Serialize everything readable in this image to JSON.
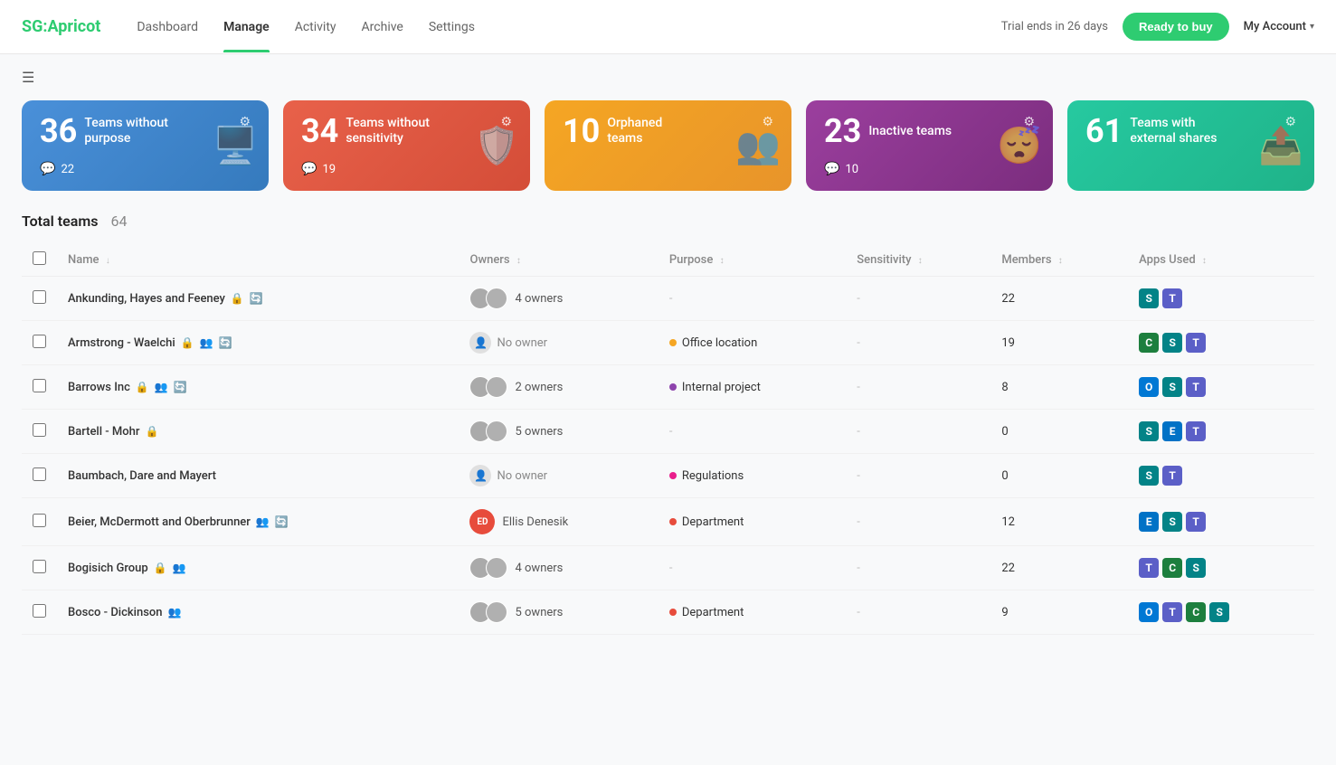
{
  "brand": {
    "logo_sg": "SG:",
    "logo_apricot": "Apricot"
  },
  "nav": {
    "links": [
      {
        "label": "Dashboard",
        "active": false
      },
      {
        "label": "Manage",
        "active": true
      },
      {
        "label": "Activity",
        "active": false
      },
      {
        "label": "Archive",
        "active": false
      },
      {
        "label": "Settings",
        "active": false
      }
    ],
    "trial_text": "Trial ends in 26 days",
    "ready_label": "Ready to buy",
    "my_account_label": "My Account"
  },
  "stat_cards": [
    {
      "number": "36",
      "title": "Teams without purpose",
      "badge": "22",
      "color": "blue"
    },
    {
      "number": "34",
      "title": "Teams without sensitivity",
      "badge": "19",
      "color": "red"
    },
    {
      "number": "10",
      "title": "Orphaned teams",
      "badge": "",
      "color": "orange"
    },
    {
      "number": "23",
      "title": "Inactive teams",
      "badge": "10",
      "color": "purple"
    },
    {
      "number": "61",
      "title": "Teams with external shares",
      "badge": "",
      "color": "teal"
    }
  ],
  "table": {
    "total_label": "Total teams",
    "total_count": "64",
    "columns": [
      "Name",
      "Owners",
      "Purpose",
      "Sensitivity",
      "Members",
      "Apps Used"
    ],
    "rows": [
      {
        "name": "Ankunding, Hayes and Feeney",
        "icons": [
          "lock",
          "refresh"
        ],
        "owner_type": "multi",
        "owner_text": "4 owners",
        "purpose": "",
        "sensitivity": "",
        "members": "22",
        "apps": [
          "sharepoint",
          "teams"
        ]
      },
      {
        "name": "Armstrong - Waelchi",
        "icons": [
          "lock",
          "group",
          "refresh"
        ],
        "owner_type": "none",
        "owner_text": "No owner",
        "purpose": "Office location",
        "purpose_color": "orange",
        "sensitivity": "",
        "members": "19",
        "apps": [
          "calendar",
          "sharepoint",
          "teams"
        ]
      },
      {
        "name": "Barrows Inc",
        "icons": [
          "lock",
          "group",
          "refresh"
        ],
        "owner_type": "multi",
        "owner_text": "2 owners",
        "purpose": "Internal project",
        "purpose_color": "purple",
        "sensitivity": "",
        "members": "8",
        "apps": [
          "outlook",
          "sharepoint",
          "teams"
        ]
      },
      {
        "name": "Bartell - Mohr",
        "icons": [
          "lock"
        ],
        "owner_type": "multi",
        "owner_text": "5 owners",
        "purpose": "",
        "sensitivity": "",
        "members": "0",
        "apps": [
          "sharepoint",
          "exchange",
          "teams"
        ]
      },
      {
        "name": "Baumbach, Dare and Mayert",
        "icons": [],
        "owner_type": "none",
        "owner_text": "No owner",
        "purpose": "Regulations",
        "purpose_color": "pink",
        "sensitivity": "",
        "members": "0",
        "apps": [
          "sharepoint",
          "teams"
        ]
      },
      {
        "name": "Beier, McDermott and Oberbrunner",
        "icons": [
          "group",
          "refresh"
        ],
        "owner_type": "named",
        "owner_text": "Ellis Denesik",
        "owner_initials": "ED",
        "purpose": "Department",
        "purpose_color": "red",
        "sensitivity": "",
        "members": "12",
        "apps": [
          "exchange",
          "sharepoint",
          "teams"
        ]
      },
      {
        "name": "Bogisich Group",
        "icons": [
          "lock",
          "group"
        ],
        "owner_type": "multi",
        "owner_text": "4 owners",
        "purpose": "",
        "sensitivity": "",
        "members": "22",
        "apps": [
          "teams",
          "calendar",
          "sharepoint"
        ]
      },
      {
        "name": "Bosco - Dickinson",
        "icons": [
          "group"
        ],
        "owner_type": "multi",
        "owner_text": "5 owners",
        "purpose": "Department",
        "purpose_color": "red",
        "sensitivity": "",
        "members": "9",
        "apps": [
          "outlook",
          "teams",
          "calendar",
          "sharepoint"
        ]
      }
    ]
  }
}
